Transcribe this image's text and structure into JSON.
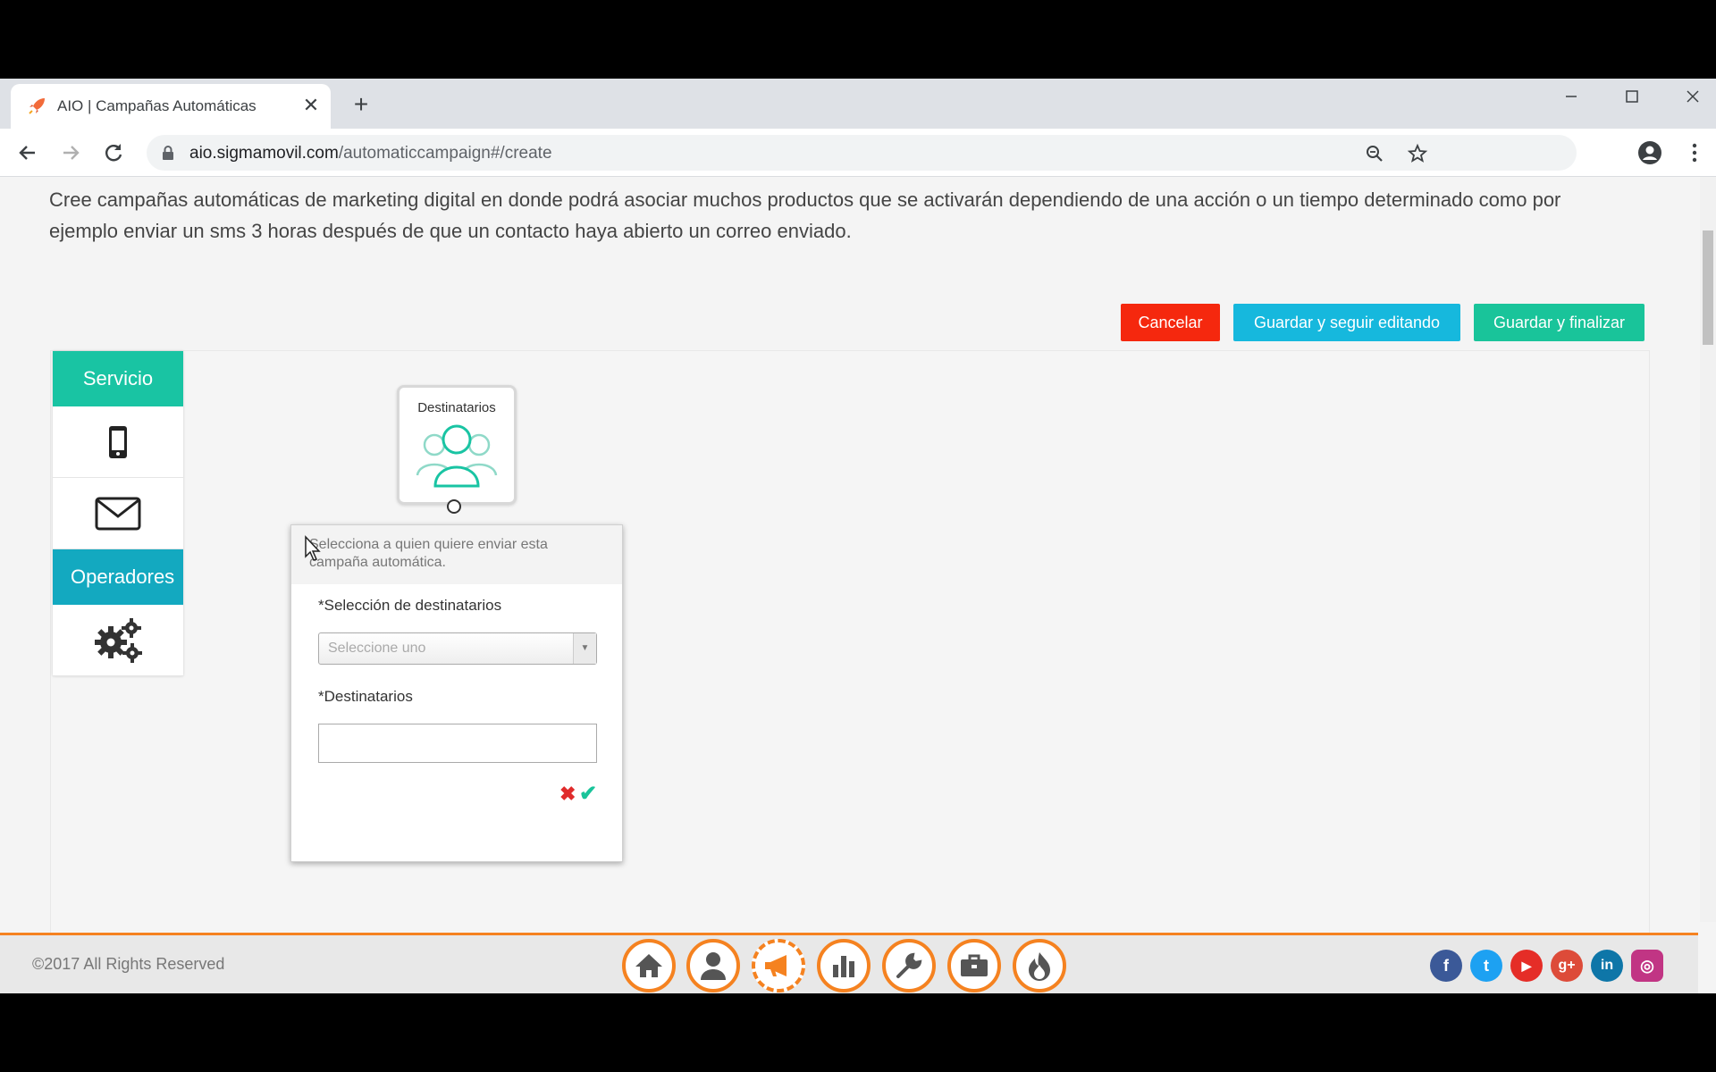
{
  "browser": {
    "tab_title": "AIO | Campañas Automáticas",
    "url_host": "aio.sigmamovil.com",
    "url_path": "/automaticcampaign#/create"
  },
  "page": {
    "intro": "Cree campañas automáticas de marketing digital en donde podrá asociar muchos productos que se activarán dependiendo de una acción o un tiempo determinado como por ejemplo enviar un sms 3 horas después de que un contacto haya abierto un correo enviado.",
    "buttons": {
      "cancel": "Cancelar",
      "save_edit": "Guardar y seguir editando",
      "save_finish": "Guardar y finalizar"
    }
  },
  "palette": {
    "service_header": "Servicio",
    "service_items": [
      "mobile-phone-icon",
      "envelope-icon"
    ],
    "operators_header": "Operadores",
    "operator_items": [
      "gears-icon"
    ]
  },
  "node": {
    "title": "Destinatarios",
    "icon": "users-icon"
  },
  "popup": {
    "help": "Selecciona a quien quiere enviar esta campaña automática.",
    "selection_label": "*Selección de destinatarios",
    "selection_placeholder": "Seleccione uno",
    "recipients_label": "*Destinatarios",
    "recipients_value": ""
  },
  "footer": {
    "copyright": "©2017 All Rights Reserved",
    "nav_icons": [
      "home-icon",
      "user-icon",
      "megaphone-icon",
      "bar-chart-icon",
      "wrench-icon",
      "briefcase-icon",
      "flame-icon"
    ],
    "social": [
      {
        "name": "facebook",
        "glyph": "f",
        "color": "#3b5998"
      },
      {
        "name": "twitter",
        "glyph": "t",
        "color": "#1da1f2"
      },
      {
        "name": "youtube",
        "glyph": "▶",
        "color": "#e52d27"
      },
      {
        "name": "google-plus",
        "glyph": "g+",
        "color": "#dd4b39"
      },
      {
        "name": "linkedin",
        "glyph": "in",
        "color": "#0e76a8"
      },
      {
        "name": "instagram",
        "glyph": "◎",
        "color": "#c13584"
      }
    ]
  },
  "colors": {
    "accent_orange": "#f58220",
    "teal": "#19c4a3",
    "cancel_red": "#f5280e",
    "cyan": "#16b8dd",
    "green": "#19c49a"
  }
}
